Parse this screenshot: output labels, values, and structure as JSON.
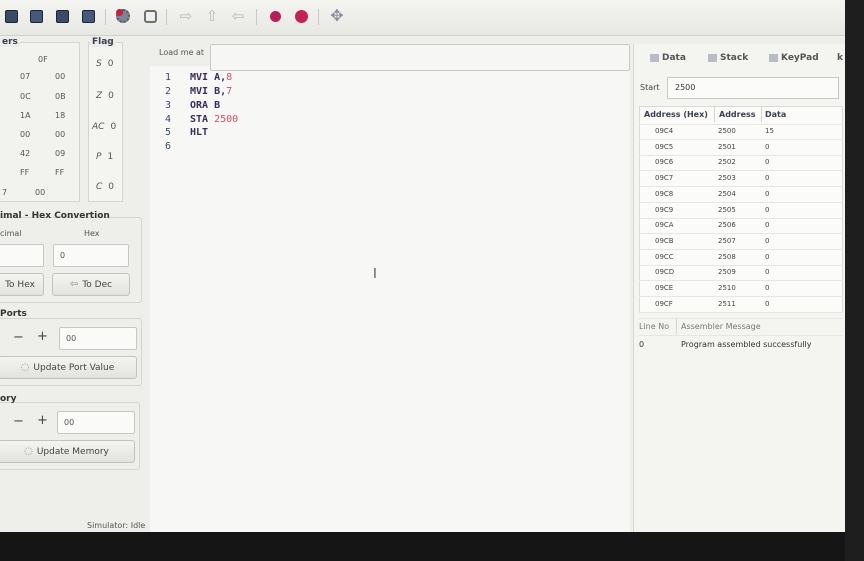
{
  "toolbar": {
    "icons": [
      "new-file-icon",
      "save-icon",
      "save-as-icon",
      "print-icon",
      "assemble-icon",
      "debug-icon",
      "step-icon",
      "step-up-icon",
      "step-back-icon",
      "run-icon",
      "stop-icon",
      "move-icon"
    ]
  },
  "registers": {
    "title": "ers",
    "top_value": "0F",
    "rows": [
      [
        "07",
        "00"
      ],
      [
        "0C",
        "0B"
      ],
      [
        "1A",
        "18"
      ],
      [
        "00",
        "00"
      ],
      [
        "42",
        "09"
      ],
      [
        "FF",
        "FF"
      ]
    ],
    "last_prefix": "7",
    "last_value": "00"
  },
  "flags": {
    "title": "Flag",
    "items": [
      {
        "name": "S",
        "value": "0"
      },
      {
        "name": "Z",
        "value": "0"
      },
      {
        "name": "AC",
        "value": "0"
      },
      {
        "name": "P",
        "value": "1"
      },
      {
        "name": "C",
        "value": "0"
      }
    ]
  },
  "converter": {
    "title": "imal - Hex Convertion",
    "decimal_label": "cimal",
    "hex_label": "Hex",
    "decimal_value": "",
    "hex_value": "0",
    "to_hex_label": "To Hex",
    "to_dec_label": "To Dec"
  },
  "ports": {
    "title": "Ports",
    "minus": "−",
    "plus": "+",
    "value": "00",
    "update_label": "Update Port Value"
  },
  "memory": {
    "title": "ory",
    "minus": "−",
    "plus": "+",
    "value": "00",
    "update_label": "Update Memory"
  },
  "editor": {
    "load_label": "Load me at",
    "load_value": "",
    "lines": [
      {
        "no": "1",
        "mnemonic": "MVI",
        "operand": "A,",
        "operand_value": "8"
      },
      {
        "no": "2",
        "mnemonic": "MVI",
        "operand": "B,",
        "operand_value": "7"
      },
      {
        "no": "3",
        "mnemonic": "ORA",
        "operand": "B",
        "operand_value": ""
      },
      {
        "no": "4",
        "mnemonic": "STA",
        "operand": "",
        "operand_value": "2500"
      },
      {
        "no": "5",
        "mnemonic": "HLT",
        "operand": "",
        "operand_value": ""
      },
      {
        "no": "6",
        "mnemonic": "",
        "operand": "",
        "operand_value": ""
      }
    ]
  },
  "right_panel": {
    "tabs": [
      "Data",
      "Stack",
      "KeyPad",
      "k"
    ],
    "start_label": "Start",
    "start_value": "2500",
    "columns": [
      "Address (Hex)",
      "Address",
      "Data"
    ],
    "rows": [
      [
        "09C4",
        "2500",
        "15"
      ],
      [
        "09C5",
        "2501",
        "0"
      ],
      [
        "09C6",
        "2502",
        "0"
      ],
      [
        "09C7",
        "2503",
        "0"
      ],
      [
        "09C8",
        "2504",
        "0"
      ],
      [
        "09C9",
        "2505",
        "0"
      ],
      [
        "09CA",
        "2506",
        "0"
      ],
      [
        "09CB",
        "2507",
        "0"
      ],
      [
        "09CC",
        "2508",
        "0"
      ],
      [
        "09CD",
        "2509",
        "0"
      ],
      [
        "09CE",
        "2510",
        "0"
      ],
      [
        "09CF",
        "2511",
        "0"
      ]
    ],
    "message_columns": [
      "Line No",
      "Assembler Message"
    ],
    "messages": [
      {
        "line": "0",
        "text": "Program assembled successfully"
      }
    ]
  },
  "status": {
    "text": "Simulator: Idle"
  },
  "colors": {
    "accent_red": "#cc4f6a",
    "code_text": "#3a2d5e",
    "background": "#eeeeea"
  }
}
